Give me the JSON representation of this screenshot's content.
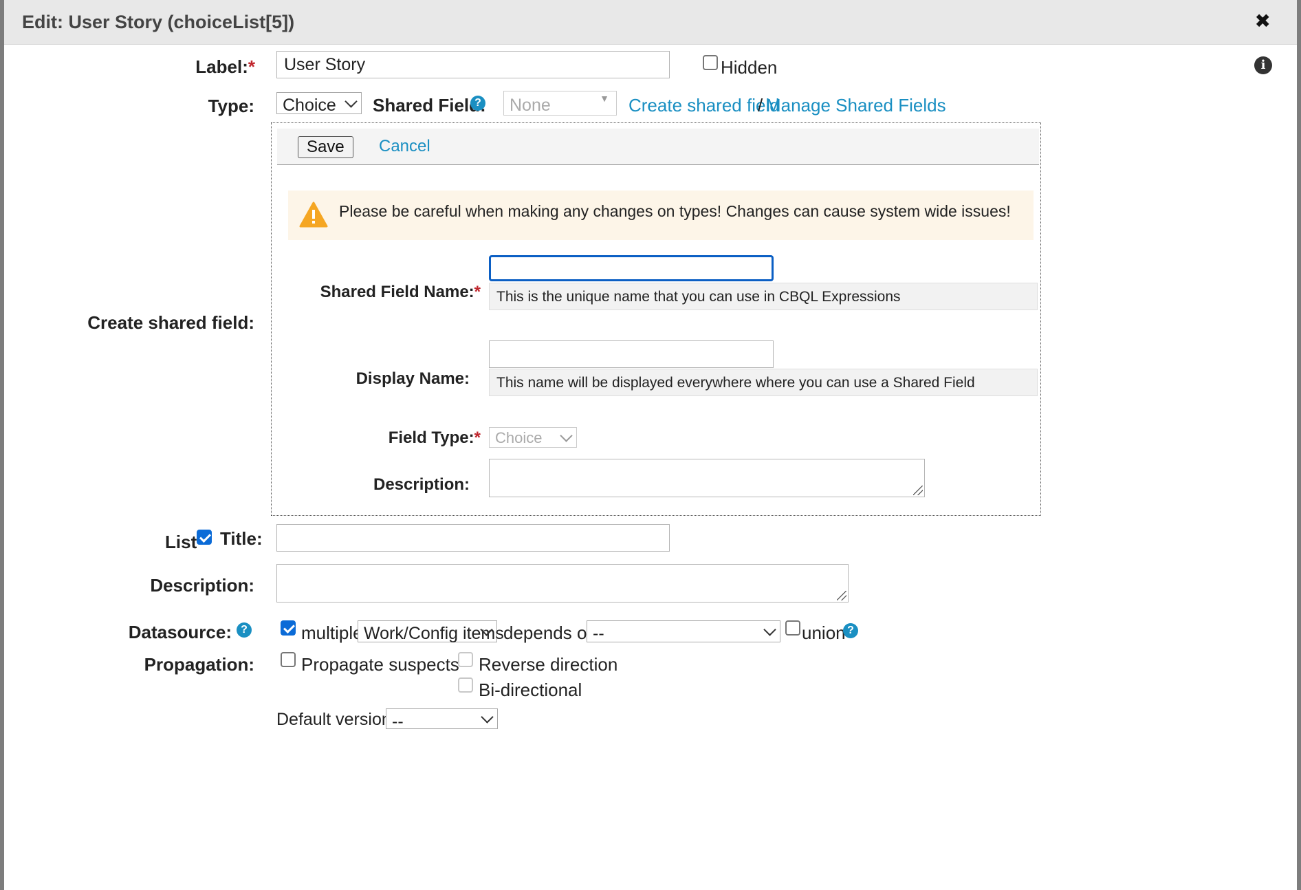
{
  "dialog": {
    "title": "Edit: User Story (choiceList[5])",
    "close_glyph": "✖",
    "info_glyph": "i"
  },
  "label_row": {
    "label": "Label:",
    "required_mark": "*",
    "value": "User Story",
    "hidden_label": "Hidden",
    "hidden_checked": false
  },
  "type_row": {
    "label": "Type:",
    "type_value": "Choice",
    "shared_field_label": "Shared Field:",
    "shared_field_value": "None",
    "create_link": "Create shared field",
    "separator": "/",
    "manage_link": "Manage Shared Fields",
    "help_glyph": "?"
  },
  "create_shared": {
    "section_label": "Create shared field:",
    "save_label": "Save",
    "cancel_label": "Cancel",
    "warning_text": "Please be careful when making any changes on types! Changes can cause system wide issues!",
    "warning_glyph": "!",
    "shared_field_name_label": "Shared Field Name:",
    "shared_field_name_value": "",
    "shared_field_name_hint": "This is the unique name that you can use in CBQL Expressions",
    "display_name_label": "Display Name:",
    "display_name_value": "",
    "display_name_hint": "This name will be displayed everywhere where you can use a Shared Field",
    "field_type_label": "Field Type:",
    "field_type_value": "Choice",
    "description_label": "Description:"
  },
  "list_title": {
    "list_label": "List",
    "list_checked": true,
    "title_label": "Title:",
    "title_value": ""
  },
  "description": {
    "label": "Description:"
  },
  "datasource": {
    "label": "Datasource:",
    "multiple_checked": true,
    "multiple_label": "multiple",
    "source_value": "Work/Config items",
    "depends_on_label": "depends on",
    "depends_on_value": "--",
    "union_label": "union",
    "union_checked": false
  },
  "propagation": {
    "label": "Propagation:",
    "propagate_suspects_label": "Propagate suspects",
    "reverse_direction_label": "Reverse direction",
    "bidirectional_label": "Bi-directional"
  },
  "default_version": {
    "label": "Default version:",
    "value": "--"
  },
  "colors": {
    "link": "#1a8fc2",
    "required": "#c0262d",
    "checkbox_checked": "#0b6bd7",
    "warning_bg": "#fdf5e8",
    "warning_icon": "#f5a623",
    "focus_border": "#0b5fc4"
  }
}
